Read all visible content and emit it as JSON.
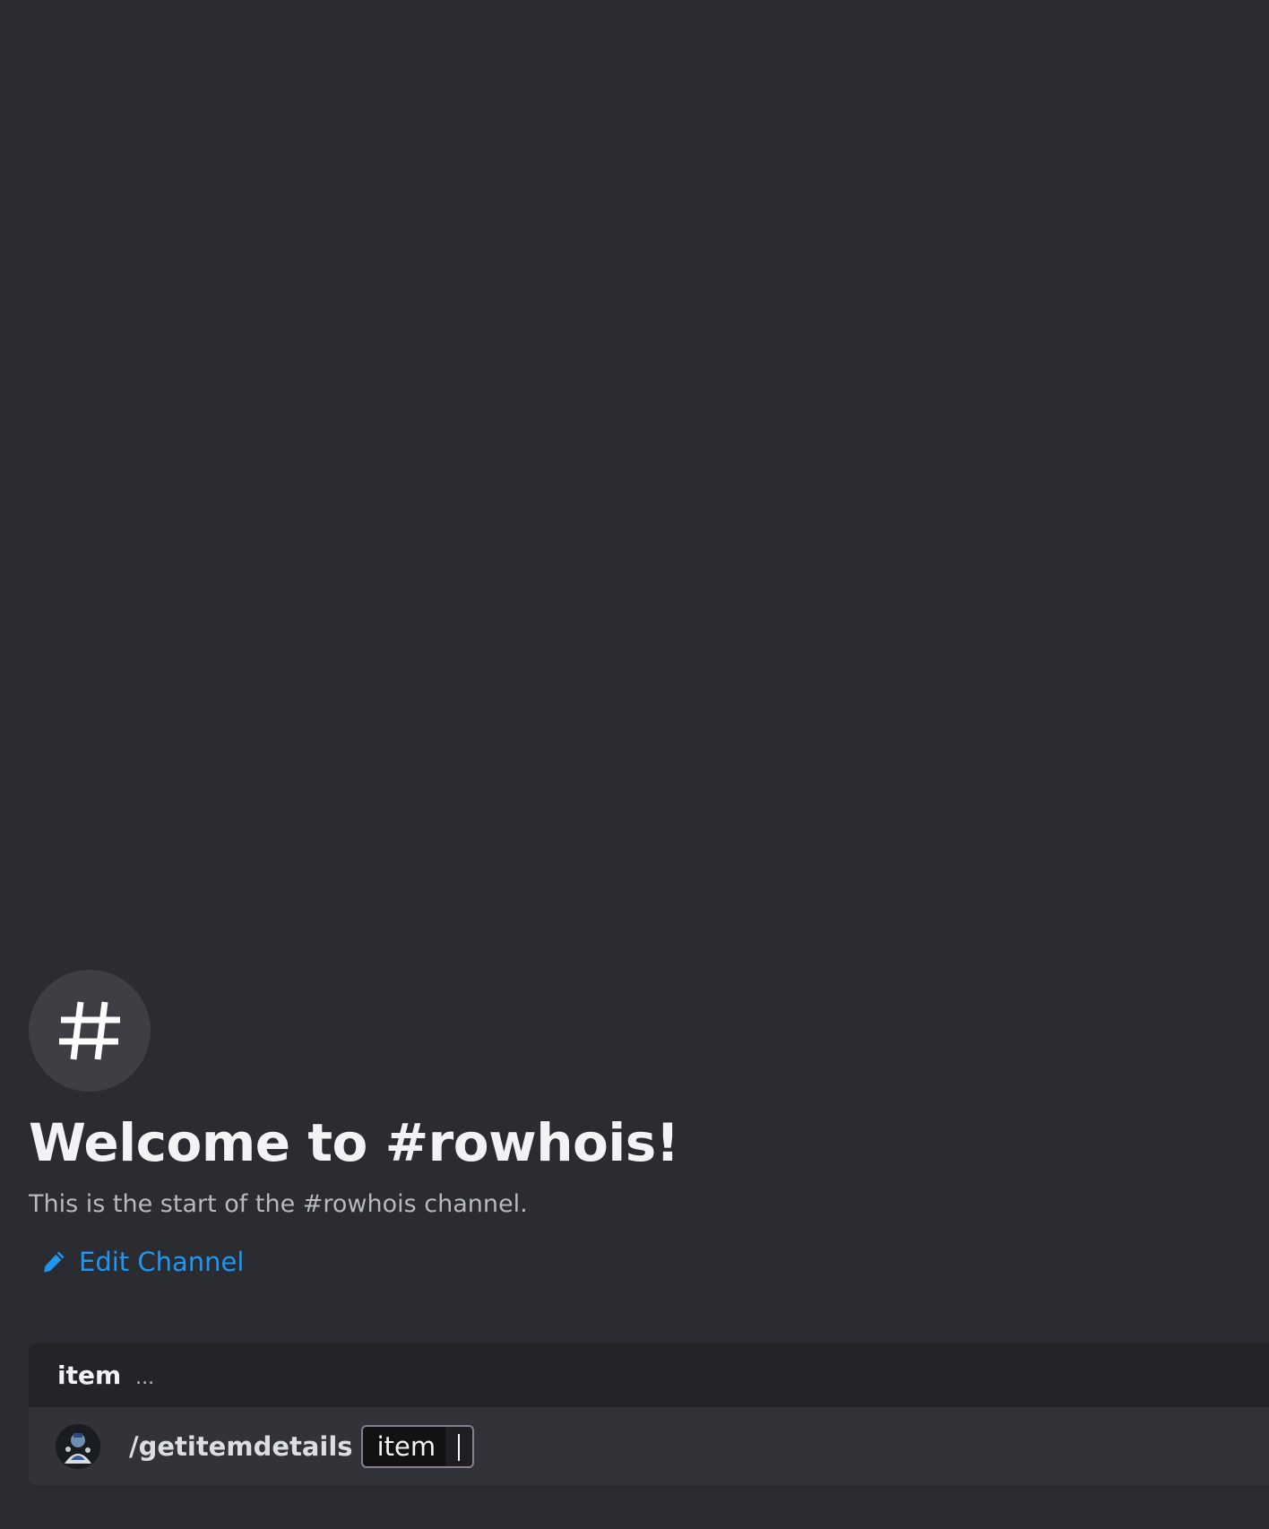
{
  "channel": {
    "hash_symbol": "#",
    "welcome_title": "Welcome to #rowhois!",
    "welcome_subtitle": "This is the start of the #rowhois channel.",
    "edit_channel_label": "Edit Channel"
  },
  "command_panel": {
    "header_label": "item",
    "header_ellipsis": "...",
    "command_name": "/getitemdetails",
    "option_label": "item"
  },
  "colors": {
    "background": "#2b2c31",
    "link": "#1e97f3",
    "option_border": "#8d7b95"
  },
  "icons": {
    "hash": "hash-icon",
    "edit": "pencil-icon",
    "avatar": "bot-avatar"
  }
}
